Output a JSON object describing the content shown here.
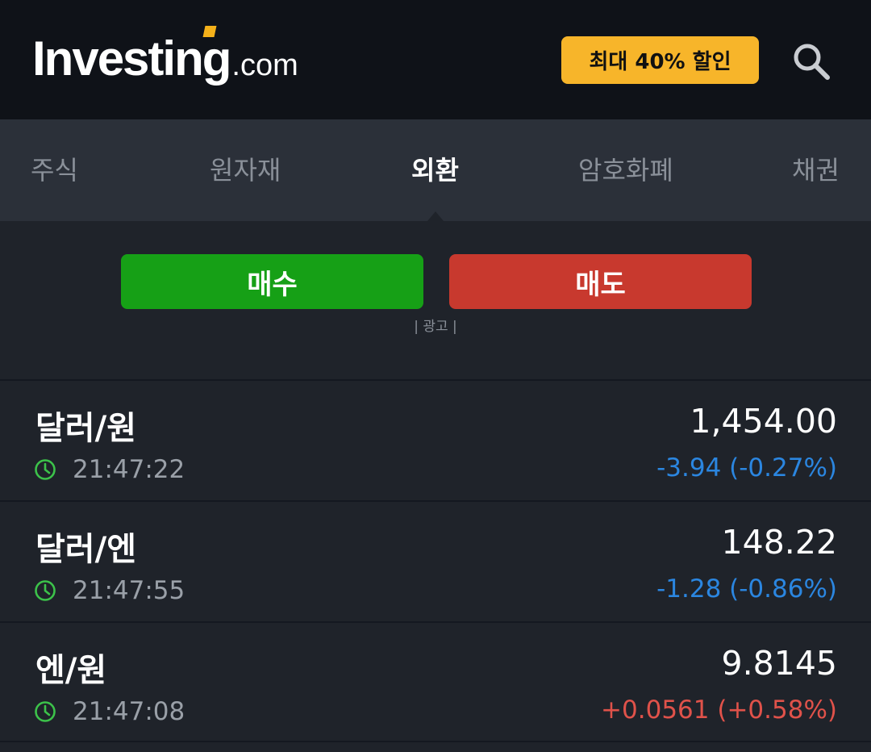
{
  "header": {
    "logo_main": "Investing",
    "logo_suffix": ".com",
    "promo_label": "최대 40% 할인"
  },
  "tabs": [
    {
      "label": "주식",
      "active": false
    },
    {
      "label": "원자재",
      "active": false
    },
    {
      "label": "외환",
      "active": true
    },
    {
      "label": "암호화폐",
      "active": false
    },
    {
      "label": "채권",
      "active": false
    }
  ],
  "ad": {
    "buy_label": "매수",
    "sell_label": "매도",
    "ad_label": "| 광고 |"
  },
  "quotes": [
    {
      "pair": "달러/원",
      "time": "21:47:22",
      "price": "1,454.00",
      "change": "-3.94 (-0.27%)",
      "direction": "down"
    },
    {
      "pair": "달러/엔",
      "time": "21:47:55",
      "price": "148.22",
      "change": "-1.28 (-0.86%)",
      "direction": "down"
    },
    {
      "pair": "엔/원",
      "time": "21:47:08",
      "price": "9.8145",
      "change": "+0.0561 (+0.58%)",
      "direction": "up"
    }
  ],
  "colors": {
    "accent": "#f7b52a",
    "buy": "#16a016",
    "sell": "#c8392e",
    "negative": "#2b86e0",
    "positive": "#e0524a",
    "clock": "#3cc24a"
  },
  "icons": {
    "search": "search-icon",
    "clock": "clock-icon"
  }
}
